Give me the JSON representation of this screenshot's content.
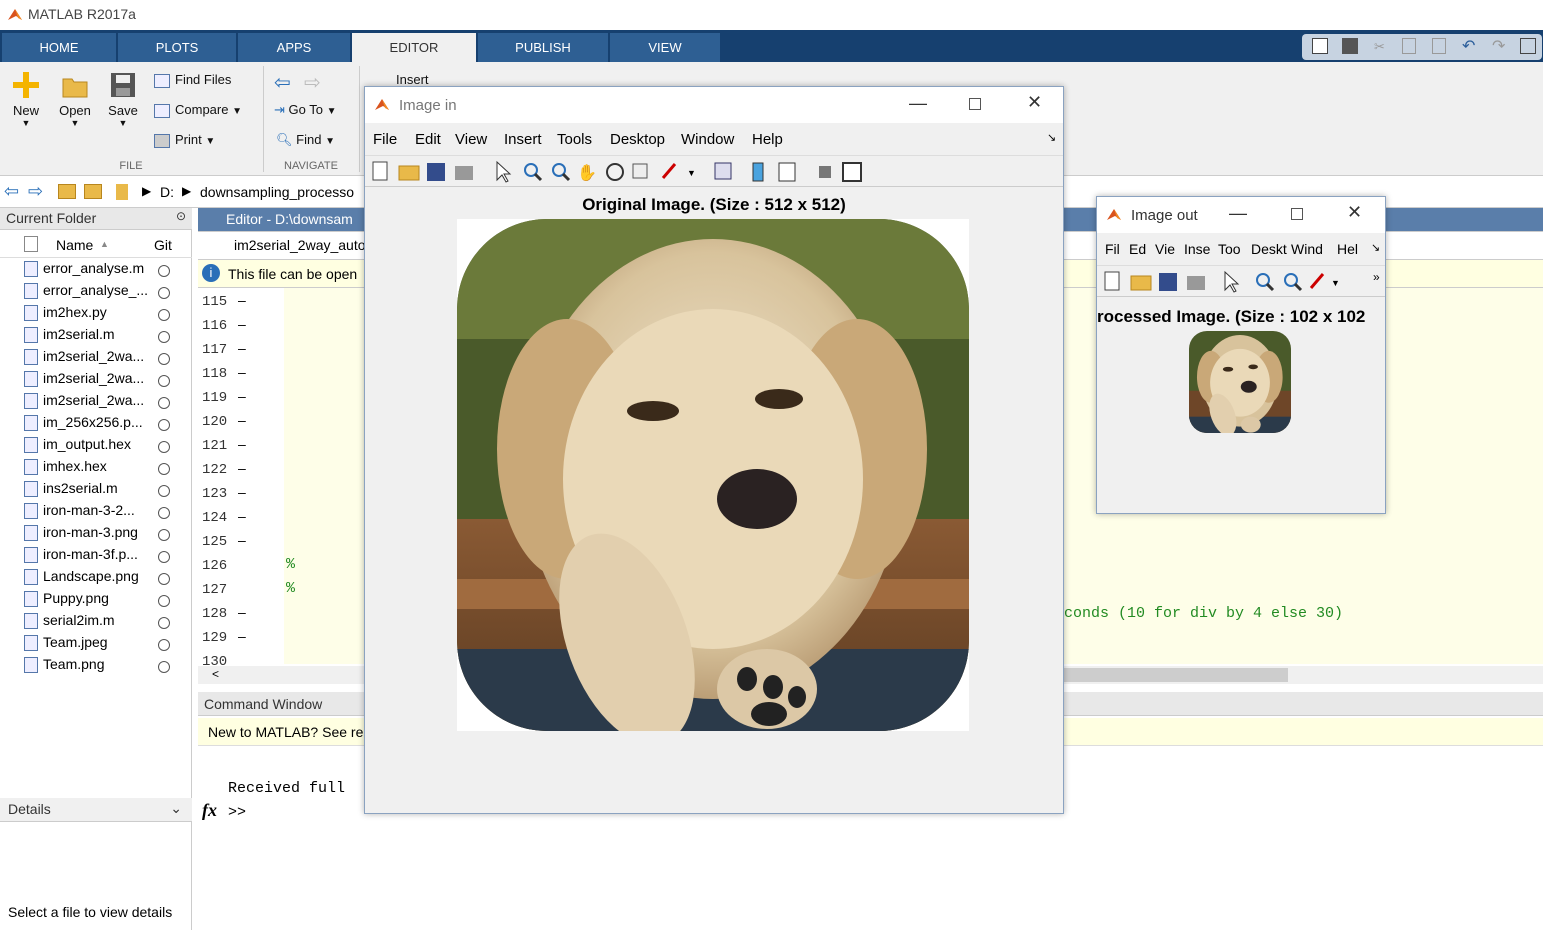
{
  "app": {
    "title": "MATLAB R2017a"
  },
  "tabs": [
    "HOME",
    "PLOTS",
    "APPS",
    "EDITOR",
    "PUBLISH",
    "VIEW"
  ],
  "ribbon": {
    "new": "New",
    "open": "Open",
    "save": "Save",
    "find_files": "Find Files",
    "compare": "Compare",
    "print": "Print",
    "file_section": "FILE",
    "goto": "Go To",
    "find": "Find",
    "navigate_section": "NAVIGATE",
    "insert": "Insert"
  },
  "address": {
    "drive": "D:",
    "folder": "downsampling_processo"
  },
  "current_folder": {
    "title": "Current Folder",
    "col_name": "Name",
    "col_git": "Git",
    "files": [
      "error_analyse.m",
      "error_analyse_...",
      "im2hex.py",
      "im2serial.m",
      "im2serial_2wa...",
      "im2serial_2wa...",
      "im2serial_2wa...",
      "im_256x256.p...",
      "im_output.hex",
      "imhex.hex",
      "ins2serial.m",
      "iron-man-3-2...",
      "iron-man-3.png",
      "iron-man-3f.p...",
      "Landscape.png",
      "Puppy.png",
      "serial2im.m",
      "Team.jpeg",
      "Team.png"
    ]
  },
  "details": {
    "title": "Details",
    "hint": "Select a file to view details"
  },
  "editor": {
    "title": "Editor - D:\\downsam",
    "tab": "im2serial_2way_auto",
    "notice": "This file can be open",
    "lines": [
      "115",
      "116",
      "117",
      "118",
      "119",
      "120",
      "121",
      "122",
      "123",
      "124",
      "125",
      "126",
      "127",
      "128",
      "129",
      "130"
    ],
    "comment1": "%",
    "comment2": "%",
    "code_right": "conds (10 for div by 4 else 30)"
  },
  "command": {
    "title": "Command Window",
    "notice": "New to MATLAB? See re",
    "output": "Received full",
    "prompt": ">>",
    "fx": "fx"
  },
  "fig_in": {
    "title": "Image in",
    "menu": [
      "File",
      "Edit",
      "View",
      "Insert",
      "Tools",
      "Desktop",
      "Window",
      "Help"
    ],
    "caption": "Original Image.  (Size : 512 x 512)"
  },
  "fig_out": {
    "title": "Image out",
    "menu": [
      "Fil",
      "Ed",
      "Vie",
      "Inse",
      "Too",
      "Deskt",
      "Wind",
      "Hel"
    ],
    "caption": "rocessed Image.   (Size : 102 x 102"
  },
  "colors": {
    "tabbar": "#16406f",
    "tab": "#2e5f93",
    "ribbon": "#f0f0f0",
    "notice": "#ffffe1",
    "comment": "#228b22"
  }
}
